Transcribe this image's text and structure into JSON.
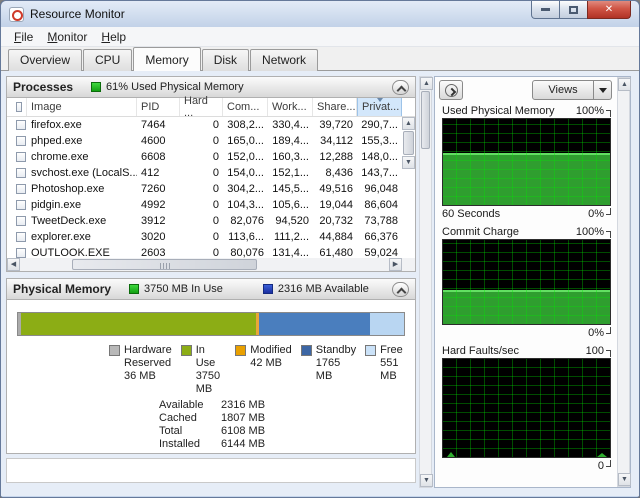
{
  "window": {
    "title": "Resource Monitor"
  },
  "menu": {
    "items": [
      "File",
      "Monitor",
      "Help"
    ]
  },
  "tabs": [
    {
      "label": "Overview",
      "active": false
    },
    {
      "label": "CPU",
      "active": false
    },
    {
      "label": "Memory",
      "active": true
    },
    {
      "label": "Disk",
      "active": false
    },
    {
      "label": "Network",
      "active": false
    }
  ],
  "processes": {
    "title": "Processes",
    "status": "61% Used Physical Memory",
    "columns": [
      "Image",
      "PID",
      "Hard ...",
      "Com...",
      "Work...",
      "Share...",
      "Privat..."
    ],
    "sorted_column_index": 6,
    "rows": [
      {
        "image": "firefox.exe",
        "pid": "7464",
        "hard": "0",
        "commit": "308,2...",
        "working": "330,4...",
        "shareable": "39,720",
        "private": "290,7..."
      },
      {
        "image": "phped.exe",
        "pid": "4600",
        "hard": "0",
        "commit": "165,0...",
        "working": "189,4...",
        "shareable": "34,112",
        "private": "155,3..."
      },
      {
        "image": "chrome.exe",
        "pid": "6608",
        "hard": "0",
        "commit": "152,0...",
        "working": "160,3...",
        "shareable": "12,288",
        "private": "148,0..."
      },
      {
        "image": "svchost.exe (LocalS...",
        "pid": "412",
        "hard": "0",
        "commit": "154,0...",
        "working": "152,1...",
        "shareable": "8,436",
        "private": "143,7..."
      },
      {
        "image": "Photoshop.exe",
        "pid": "7260",
        "hard": "0",
        "commit": "304,2...",
        "working": "145,5...",
        "shareable": "49,516",
        "private": "96,048"
      },
      {
        "image": "pidgin.exe",
        "pid": "4992",
        "hard": "0",
        "commit": "104,3...",
        "working": "105,6...",
        "shareable": "19,044",
        "private": "86,604"
      },
      {
        "image": "TweetDeck.exe",
        "pid": "3912",
        "hard": "0",
        "commit": "82,076",
        "working": "94,520",
        "shareable": "20,732",
        "private": "73,788"
      },
      {
        "image": "explorer.exe",
        "pid": "3020",
        "hard": "0",
        "commit": "113,6...",
        "working": "111,2...",
        "shareable": "44,884",
        "private": "66,376"
      },
      {
        "image": "OUTLOOK.EXE",
        "pid": "2603",
        "hard": "0",
        "commit": "80,076",
        "working": "131,4...",
        "shareable": "61,480",
        "private": "59,024"
      }
    ]
  },
  "physical_memory": {
    "title": "Physical Memory",
    "in_use_label": "3750 MB In Use",
    "available_label": "2316 MB Available",
    "total_mb": 6144,
    "segments": [
      {
        "name": "Hardware Reserved",
        "mb": 36,
        "pct": 0.7,
        "color": "#ababab"
      },
      {
        "name": "In Use",
        "mb": 3750,
        "pct": 61.0,
        "color": "#8cad15"
      },
      {
        "name": "Modified",
        "mb": 42,
        "pct": 0.7,
        "color": "#e9a63a"
      },
      {
        "name": "Standby",
        "mb": 1765,
        "pct": 28.7,
        "color": "#4a7ebe"
      },
      {
        "name": "Free",
        "mb": 551,
        "pct": 8.9,
        "color": "#b9d6f2"
      }
    ],
    "legend": [
      {
        "label": "Hardware Reserved",
        "value": "36 MB",
        "color": "#b8b8b8"
      },
      {
        "label": "In Use",
        "value": "3750 MB",
        "color": "#8cad15"
      },
      {
        "label": "Modified",
        "value": "42 MB",
        "color": "#e9a000"
      },
      {
        "label": "Standby",
        "value": "1765 MB",
        "color": "#3c66a4"
      },
      {
        "label": "Free",
        "value": "551 MB",
        "color": "#cbe2f8"
      }
    ],
    "stats": [
      {
        "label": "Available",
        "value": "2316 MB"
      },
      {
        "label": "Cached",
        "value": "1807 MB"
      },
      {
        "label": "Total",
        "value": "6108 MB"
      },
      {
        "label": "Installed",
        "value": "6144 MB"
      }
    ]
  },
  "right_panel": {
    "views_label": "Views",
    "graphs": [
      {
        "title": "Used Physical Memory",
        "max_label": "100%",
        "min_label": "0%",
        "bottom_left": "60 Seconds",
        "fill_pct": 61,
        "height": 88,
        "spikes": false
      },
      {
        "title": "Commit Charge",
        "max_label": "100%",
        "min_label": "0%",
        "bottom_left": "",
        "fill_pct": 40,
        "height": 86,
        "spikes": false
      },
      {
        "title": "Hard Faults/sec",
        "max_label": "100",
        "min_label": "0",
        "bottom_left": "",
        "fill_pct": 0,
        "height": 100,
        "spikes": true
      }
    ]
  },
  "colors": {
    "graph_fill": "#2f9e2f",
    "graph_grid": "#00e600",
    "status_green": "#18c018",
    "status_blue": "#1b2fa0",
    "close_button_red": "#c23a2a"
  }
}
